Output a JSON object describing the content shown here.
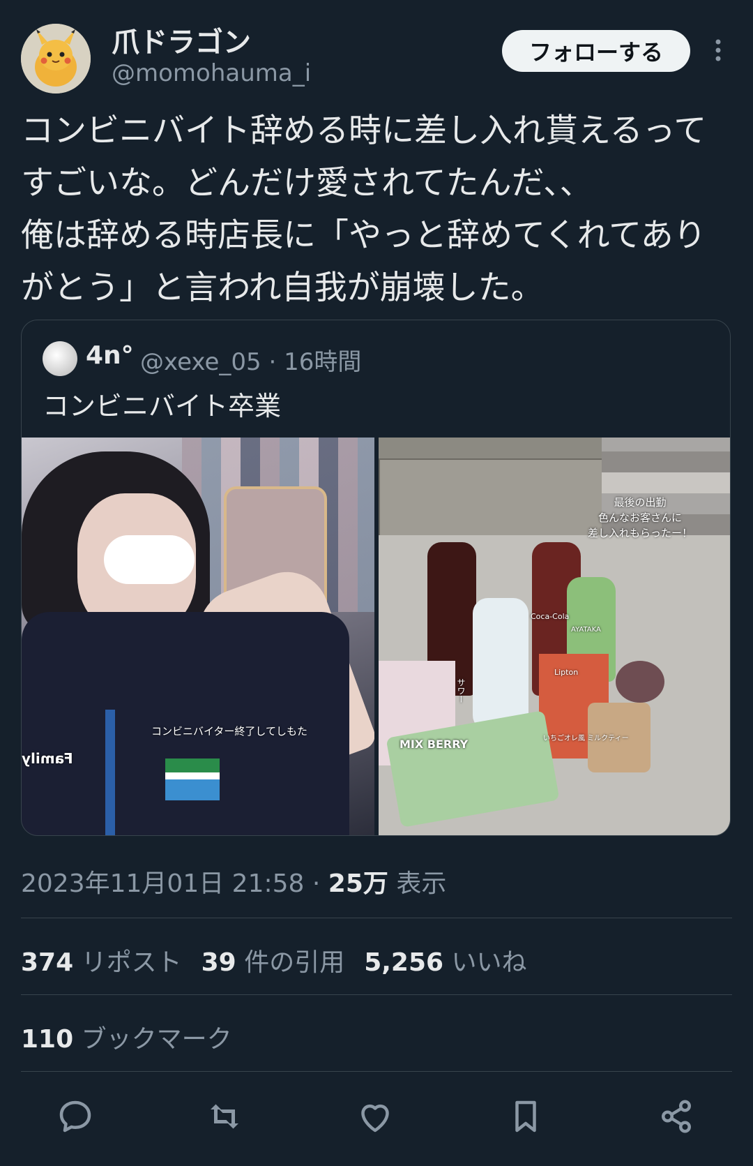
{
  "author": {
    "name": "爪ドラゴン",
    "handle": "@momohauma_i",
    "avatar_icon": "pikachu-plush-avatar",
    "follow_label": "フォローする"
  },
  "tweet": {
    "lines": [
      "コンビニバイト辞める時に差し入れ貰えるって",
      "すごいな。どんだけ愛されてたんだ、、",
      "俺は辞める時店長に「やっと辞めてくれてあり",
      "がとう」と言われ自我が崩壊した。"
    ]
  },
  "quote": {
    "name": "4n°",
    "handle": "@xexe_05",
    "separator": "·",
    "time": "16時間",
    "text": "コンビニバイト卒業",
    "photo1_caption": "コンビニバイター終了してしもた",
    "photo1_logo": "Family",
    "photo2_caption": [
      "最後の出勤",
      "色んなお客さんに",
      "差し入れもらったー！"
    ],
    "photo2_labels": {
      "mixberry": "MIX BERRY",
      "lipton": "Lipton",
      "coca": "Coca-Cola",
      "ayataka": "AYATAKA",
      "sour": "サワー",
      "ichigo": "いちごオレ風 ミルクティー"
    }
  },
  "meta": {
    "datetime": "2023年11月01日 21:58",
    "separator": "·",
    "views_count": "25万",
    "views_label": "表示"
  },
  "stats": {
    "reposts_count": "374",
    "reposts_label": "リポスト",
    "quotes_count": "39",
    "quotes_label": "件の引用",
    "likes_count": "5,256",
    "likes_label": "いいね",
    "bookmarks_count": "110",
    "bookmarks_label": "ブックマーク"
  },
  "actions": [
    "reply-icon",
    "repost-icon",
    "like-icon",
    "bookmark-icon",
    "share-icon"
  ],
  "colors": {
    "background": "#15202b",
    "text": "#e7e9ea",
    "secondary": "#8b98a5",
    "border": "#38444d"
  }
}
